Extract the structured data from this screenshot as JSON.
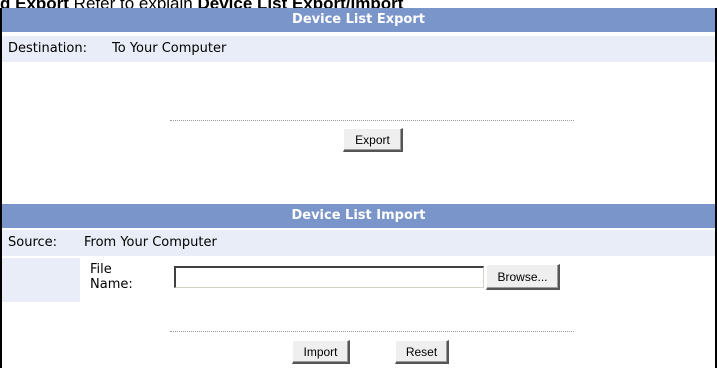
{
  "caption": {
    "text_bold_a": "d Export",
    "text_regular": " Refer to explain ",
    "text_bold_b": "Device List Export/Import"
  },
  "export_section": {
    "header": "Device List Export",
    "destination_label": "Destination:",
    "destination_value": "To Your Computer",
    "export_button": "Export"
  },
  "import_section": {
    "header": "Device List Import",
    "source_label": "Source:",
    "source_value": "From Your Computer",
    "file_name_label_line1": "File",
    "file_name_label_line2": "Name:",
    "file_input_value": "",
    "browse_button": "Browse...",
    "import_button": "Import",
    "reset_button": "Reset"
  },
  "colors": {
    "header_band": "#7a95c9",
    "row_background": "#e9edf7"
  }
}
